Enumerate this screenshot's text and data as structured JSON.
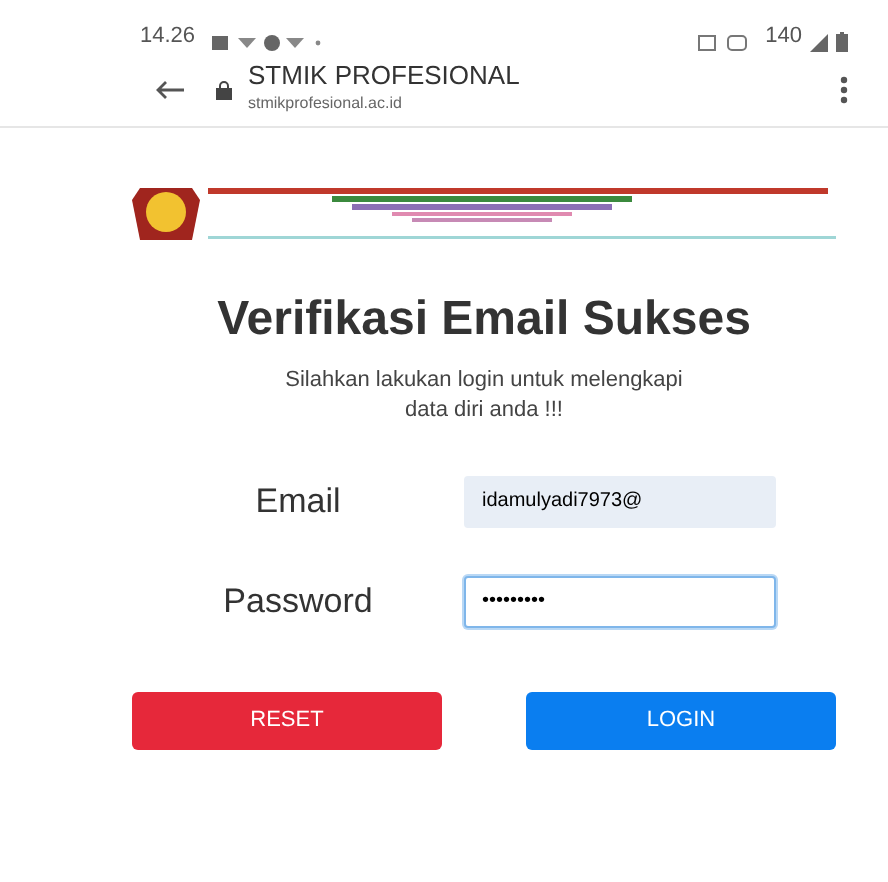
{
  "status_bar": {
    "time": "14.26",
    "battery": "140"
  },
  "browser": {
    "site_title": "STMIK PROFESIONAL",
    "url": "stmikprofesional.ac.id"
  },
  "title": "Verifikasi Email Sukses",
  "subtitle": "Silahkan lakukan login untuk melengkapi data diri anda !!!",
  "form": {
    "fields": [
      {
        "label": "Email",
        "value": "idamulyadi7973@",
        "focused": false
      },
      {
        "label": "Password",
        "value": "•••••••••",
        "focused": true
      }
    ],
    "buttons": [
      {
        "label": "RESET",
        "kind": "reset"
      },
      {
        "label": "LOGIN",
        "kind": "login"
      }
    ]
  }
}
